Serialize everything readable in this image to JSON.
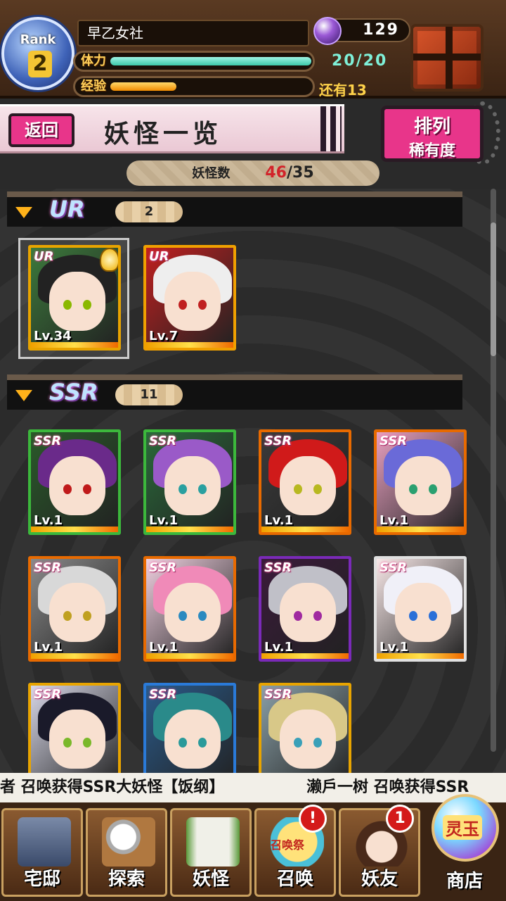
{
  "header": {
    "rank_label": "Rank",
    "rank_value": "2",
    "player_name": "早乙女社",
    "stamina_label": "体力",
    "stamina_value": "20/20",
    "stamina_fraction": 1.0,
    "exp_label": "经验",
    "exp_remaining": "还有13",
    "exp_fraction": 0.33,
    "gems": "129",
    "chest_icon": "treasure-chest-icon"
  },
  "page": {
    "back_label": "返回",
    "title": "妖怪一览",
    "sort_label_top": "排列",
    "sort_label_bottom": "稀有度",
    "count_label": "妖怪数",
    "count_current": "46",
    "count_max": "/35"
  },
  "sections": [
    {
      "rarity": "UR",
      "count": "2"
    },
    {
      "rarity": "SSR",
      "count": "11"
    }
  ],
  "ur_cards": [
    {
      "tag": "UR",
      "level": "Lv.34",
      "hair": "#222",
      "bg": "#3c7a3c",
      "eye": "#8ab800"
    },
    {
      "tag": "UR",
      "level": "Lv.7",
      "hair": "#eee",
      "bg": "#c02020",
      "eye": "#c02020"
    }
  ],
  "ssr_cards": [
    {
      "tag": "SSR",
      "level": "Lv.1",
      "hair": "#6a2a8a",
      "bg": "#2a5a2a",
      "eye": "#c01a1a"
    },
    {
      "tag": "SSR",
      "level": "Lv.1",
      "hair": "#9a5ac8",
      "bg": "#2a6a3a",
      "eye": "#2aa0a0"
    },
    {
      "tag": "SSR",
      "level": "Lv.1",
      "hair": "#d01a1a",
      "bg": "#3a3a3a",
      "eye": "#b8b820"
    },
    {
      "tag": "SSR",
      "level": "Lv.1",
      "hair": "#6a6ad8",
      "bg": "#e8a0c0",
      "eye": "#2aa070"
    },
    {
      "tag": "SSR",
      "level": "Lv.1",
      "hair": "#d8d8d8",
      "bg": "#8a8a8a",
      "eye": "#c0a020"
    },
    {
      "tag": "SSR",
      "level": "Lv.1",
      "hair": "#f08ab8",
      "bg": "#f0d0e0",
      "eye": "#2a8ac0"
    },
    {
      "tag": "SSR",
      "level": "Lv.1",
      "hair": "#c0c0c8",
      "bg": "#3a1a3a",
      "eye": "#a02aa0"
    },
    {
      "tag": "SSR",
      "level": "Lv.1",
      "hair": "#f0f0f8",
      "bg": "#f8e8e8",
      "eye": "#2a70d8"
    },
    {
      "tag": "SSR",
      "level": "",
      "hair": "#1a1a2a",
      "bg": "#d8d8e8",
      "eye": "#7ab82a"
    },
    {
      "tag": "SSR",
      "level": "",
      "hair": "#2a8a8a",
      "bg": "#2a5a8a",
      "eye": "#2a9a9a"
    },
    {
      "tag": "SSR",
      "level": "",
      "hair": "#d8c888",
      "bg": "#8aa0a8",
      "eye": "#3aa0b8"
    }
  ],
  "ticker": {
    "left": "者 召唤获得SSR大妖怪【饭纲】",
    "right": "濑戶一树 召唤获得SSR"
  },
  "nav": {
    "home": "宅邸",
    "explore": "探索",
    "yokai": "妖怪",
    "summon": "召唤",
    "summon_tag": "召唤祭",
    "summon_badge": "!",
    "friends": "妖友",
    "friends_badge": "1",
    "shop": "商店",
    "shop_tag": "灵玉"
  }
}
